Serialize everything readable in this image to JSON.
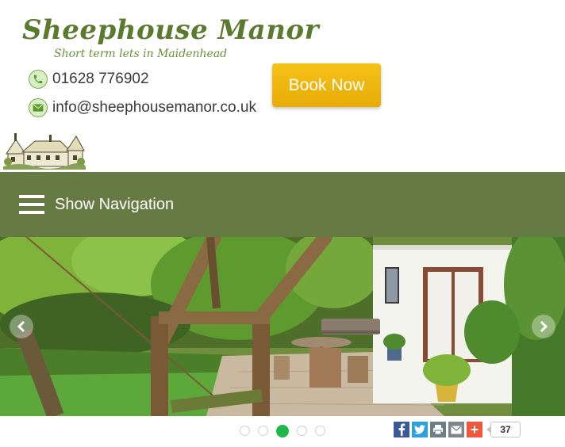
{
  "site": {
    "title": "Sheephouse Manor",
    "tagline": "Short term lets in Maidenhead"
  },
  "contact": {
    "phone": "01628 776902",
    "email": "info@sheephousemanor.co.uk",
    "phone_icon": "phone-icon",
    "email_icon": "envelope-icon"
  },
  "booking": {
    "label": "Book Now"
  },
  "nav": {
    "label": "Show Navigation",
    "icon": "hamburger-icon"
  },
  "slider": {
    "slide_count": 5,
    "active_slide": 3,
    "prev_icon": "chevron-left-icon",
    "next_icon": "chevron-right-icon"
  },
  "share": {
    "buttons": [
      "facebook-icon",
      "twitter-icon",
      "print-icon",
      "email-icon",
      "plus-icon"
    ],
    "count": "37"
  },
  "colors": {
    "brand_green": "#5a7a2e",
    "nav_bg": "#667b43",
    "book_button": "#f0b90b",
    "active_dot": "#1fb74a"
  }
}
